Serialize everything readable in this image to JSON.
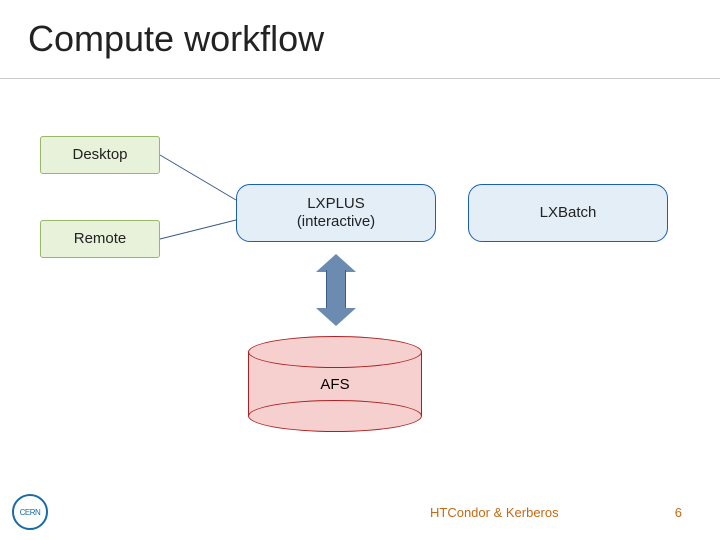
{
  "title": "Compute workflow",
  "nodes": {
    "desktop": "Desktop",
    "remote": "Remote",
    "lxplus_l1": "LXPLUS",
    "lxplus_l2": "(interactive)",
    "lxbatch": "LXBatch",
    "afs": "AFS"
  },
  "footer": {
    "talk": "HTCondor & Kerberos",
    "page": "6",
    "logo": "CERN"
  }
}
